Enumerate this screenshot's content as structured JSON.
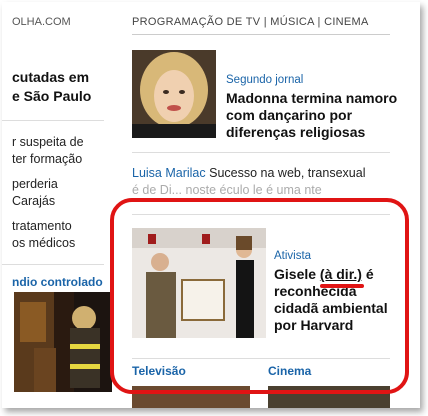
{
  "left": {
    "site": "OLHA.COM",
    "headline_lines": [
      "cutadas em",
      "e São Paulo"
    ],
    "items": [
      "r suspeita de",
      "ter formação",
      "perderia",
      "Carajás",
      "tratamento",
      "os médicos"
    ],
    "section": "ndio controlado"
  },
  "topnav": {
    "label": "PROGRAMAÇÃO DE TV | MÚSICA | CINEMA"
  },
  "story1": {
    "kicker": "Segundo jornal",
    "headline": "Madonna termina namoro com dançarino por diferenças religiosas"
  },
  "brief": {
    "name": "Luisa Marilac",
    "text": "Sucesso na web, transexual",
    "line2": "é de Di... noste éculo le é uma nte"
  },
  "story2": {
    "kicker": "Ativista",
    "headline_start": "Gisele ",
    "headline_mark": "(à dir.)",
    "headline_end": " é reconhecida cidadã ambiental por Harvard"
  },
  "sections": {
    "left": "Televisão",
    "right": "Cinema"
  },
  "colors": {
    "link_blue": "#1a64a8",
    "annotation_red": "#e01414"
  }
}
